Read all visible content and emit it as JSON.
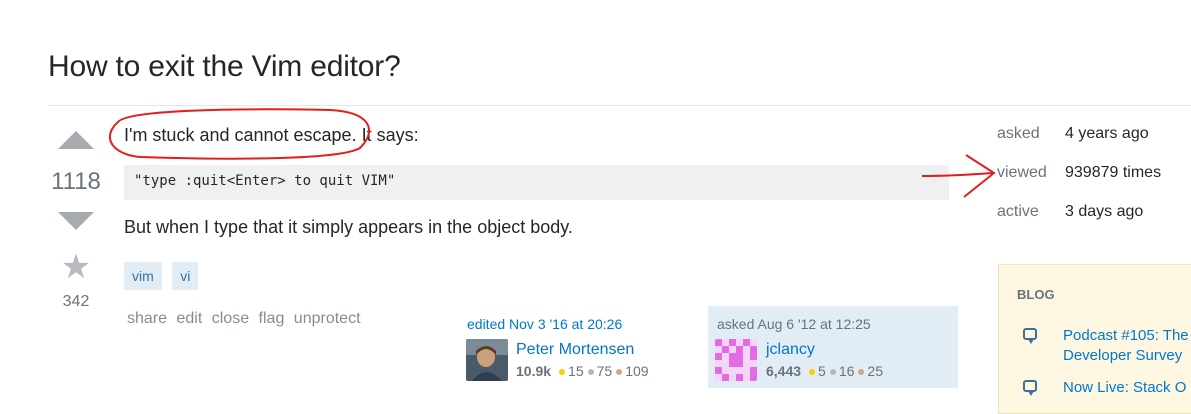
{
  "question": {
    "title": "How to exit the Vim editor?",
    "vote_count": "1118",
    "favorite_count": "342",
    "body_line1": "I'm stuck and cannot escape. It says:",
    "code": "\"type :quit<Enter> to quit VIM\"",
    "body_line2": "But when I type that it simply appears in the object body.",
    "tags": [
      "vim",
      "vi"
    ],
    "menu": [
      "share",
      "edit",
      "close",
      "flag",
      "unprotect"
    ]
  },
  "edited": {
    "action": "edited Nov 3 '16 at 20:26",
    "user": "Peter Mortensen",
    "rep": "10.9k",
    "gold": "15",
    "silver": "75",
    "bronze": "109"
  },
  "asked": {
    "action": "asked Aug 6 '12 at 12:25",
    "user": "jclancy",
    "rep": "6,443",
    "gold": "5",
    "silver": "16",
    "bronze": "25"
  },
  "stats": {
    "asked_label": "asked",
    "asked_value": "4 years ago",
    "viewed_label": "viewed",
    "viewed_value": "939879 times",
    "active_label": "active",
    "active_value": "3 days ago"
  },
  "blog": {
    "heading": "BLOG",
    "items": [
      "Podcast #105: The",
      "Developer Survey",
      "Now Live: Stack O"
    ]
  },
  "icons": {
    "upvote": "arrow-up-icon",
    "downvote": "arrow-down-icon",
    "favorite": "star-icon",
    "blog": "speech-bubble-icon"
  },
  "colors": {
    "accent": "#0077cc",
    "tag_bg": "#e1ecf4",
    "annotation": "#e0201c"
  }
}
